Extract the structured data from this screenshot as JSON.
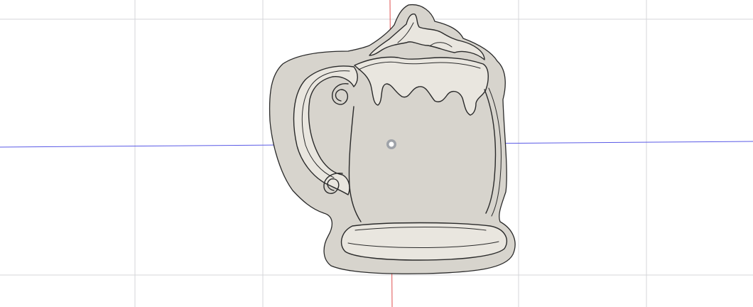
{
  "viewport": {
    "background": "#ffffff",
    "grid_color": "#d4d6da",
    "x_axis_color": "#5a5ae6",
    "y_axis_color": "#e05050",
    "origin_marker_color": "#9ea2a8"
  },
  "model": {
    "body_fill": "#d7d4cd",
    "body_shade": "#c4c0b7",
    "wall_fill": "#e9e6df",
    "edge_color": "#2a2a2a"
  }
}
